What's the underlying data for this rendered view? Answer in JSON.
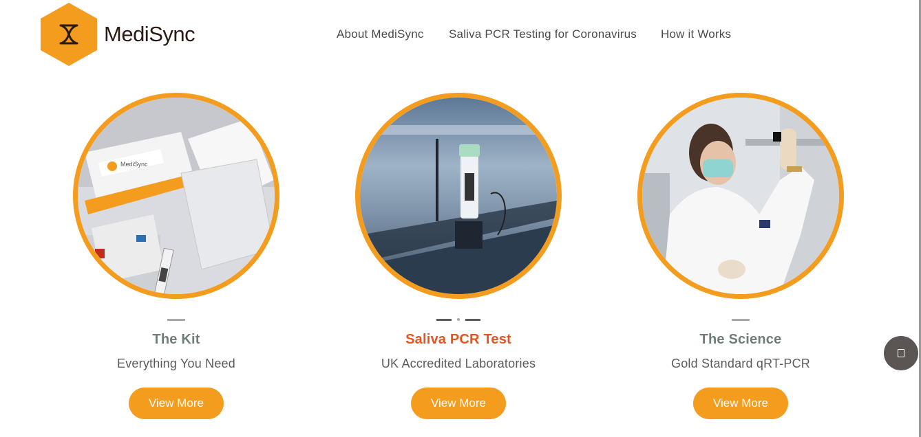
{
  "brand": {
    "name": "MediSync"
  },
  "nav": [
    {
      "label": "About MediSync"
    },
    {
      "label": "Saliva PCR Testing for Coronavirus"
    },
    {
      "label": "How it Works"
    }
  ],
  "cards": [
    {
      "title": "The Kit",
      "subtitle": "Everything You Need",
      "button": "View More",
      "image": "test-kit-photo"
    },
    {
      "title": "Saliva PCR Test",
      "subtitle": "UK Accredited Laboratories",
      "button": "View More",
      "image": "sample-tube-photo",
      "active": true
    },
    {
      "title": "The Science",
      "subtitle": "Gold Standard qRT-PCR",
      "button": "View More",
      "image": "lab-scientist-photo"
    }
  ],
  "kit_image": {
    "box_label": "MediSync"
  },
  "colors": {
    "accent": "#f39c1e",
    "active_title": "#e6531e",
    "title": "#6f7d78",
    "text": "#5b5b5b"
  },
  "floating_button": {
    "icon": "square-icon"
  }
}
